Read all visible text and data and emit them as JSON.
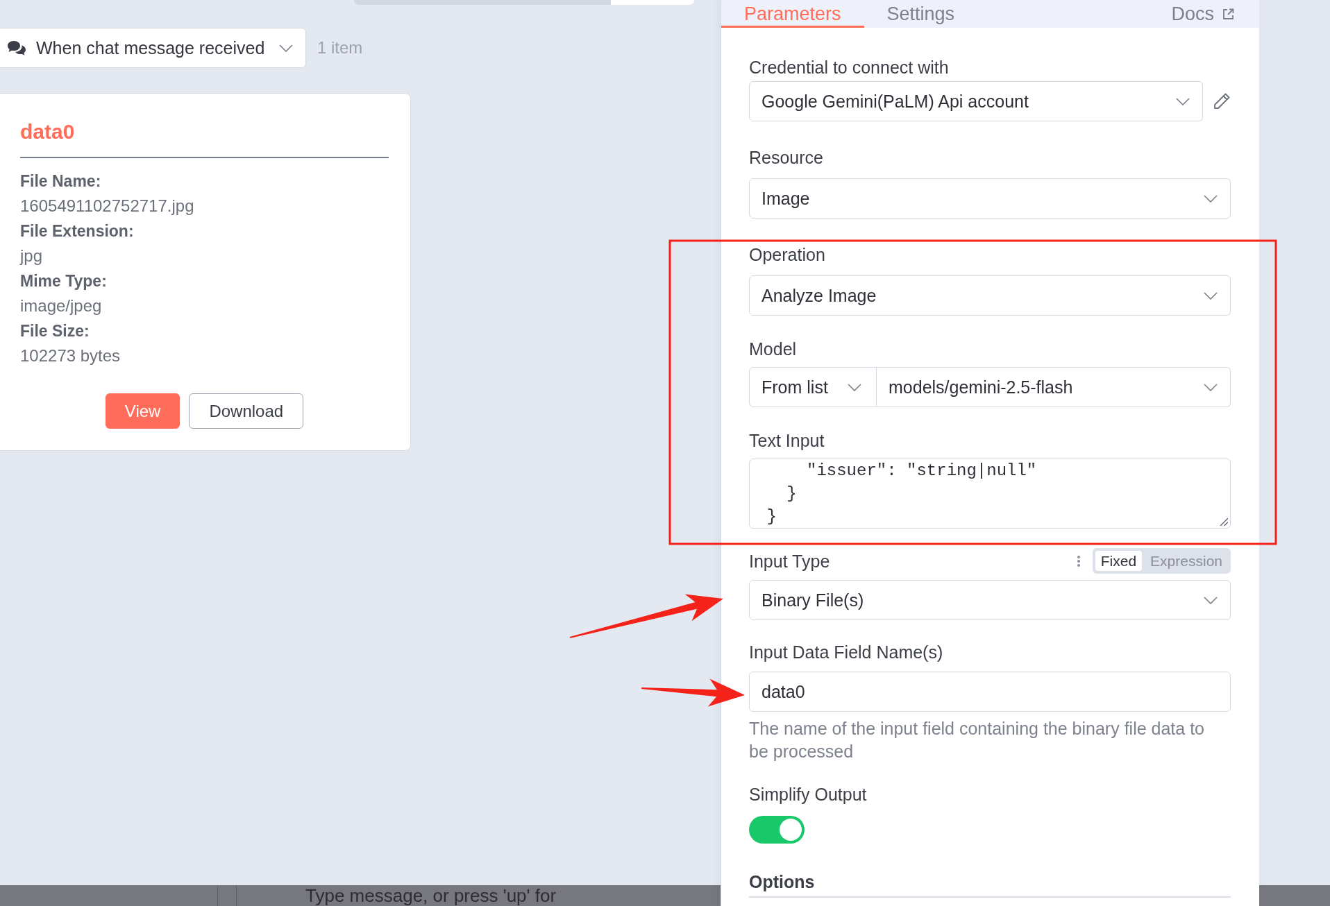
{
  "canvas": {
    "trigger_select": {
      "label": "When chat message received"
    },
    "item_count": "1 item",
    "binary_card": {
      "title": "data0",
      "properties": [
        {
          "label": "File Name:",
          "value": "1605491102752717.jpg"
        },
        {
          "label": "File Extension:",
          "value": "jpg"
        },
        {
          "label": "Mime Type:",
          "value": "image/jpeg"
        },
        {
          "label": "File Size:",
          "value": "102273 bytes"
        }
      ],
      "buttons": [
        {
          "label": "View",
          "kind": "primary"
        },
        {
          "label": "Download",
          "kind": "secondary"
        }
      ]
    }
  },
  "panel": {
    "tabs": [
      {
        "label": "Parameters",
        "selected": true
      },
      {
        "label": "Settings",
        "selected": false
      }
    ],
    "docs_link": "Docs",
    "parameters": [
      {
        "kind": "credential",
        "label": "Credential to connect with",
        "value": "Google Gemini(PaLM) Api account",
        "boxed": false,
        "pointed_at": false
      },
      {
        "kind": "select",
        "label": "Resource",
        "value": "Image",
        "boxed": false,
        "pointed_at": false
      },
      {
        "kind": "select",
        "label": "Operation",
        "value": "Analyze Image",
        "boxed": true,
        "pointed_at": false
      },
      {
        "kind": "resource_locator",
        "label": "Model",
        "mode": "From list",
        "value": "models/gemini-2.5-flash",
        "boxed": true,
        "pointed_at": false
      },
      {
        "kind": "textarea",
        "label": "Text Input",
        "lines": [
          "     \"issuer\": \"string|null\"",
          "   }",
          " }"
        ],
        "boxed": true,
        "pointed_at": false
      },
      {
        "kind": "select",
        "label": "Input Type",
        "value": "Binary File(s)",
        "modes": [
          {
            "label": "Fixed",
            "selected": true
          },
          {
            "label": "Expression",
            "selected": false
          }
        ],
        "boxed": false,
        "pointed_at": true
      },
      {
        "kind": "text",
        "label": "Input Data Field Name(s)",
        "value": "data0",
        "hint": "The name of the input field containing the binary file data to be processed",
        "boxed": false,
        "pointed_at": true
      },
      {
        "kind": "toggle",
        "label": "Simplify Output",
        "on": true,
        "boxed": false,
        "pointed_at": false
      },
      {
        "kind": "section",
        "label": "Options",
        "boxed": false,
        "pointed_at": false
      }
    ]
  },
  "chat_input": {
    "placeholder": "Type message, or press 'up' for"
  }
}
